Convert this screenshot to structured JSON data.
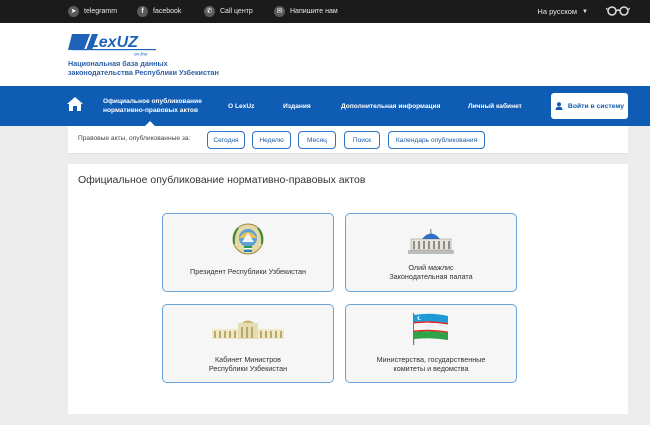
{
  "topbar": {
    "telegram": "telegramm",
    "facebook": "facebook",
    "call": "Call центр",
    "write": "Напишите нам",
    "language": "На русском"
  },
  "header": {
    "logo_text": "LexUZ",
    "logo_sub": "on-line",
    "slogan_line1": "Национальная база данных",
    "slogan_line2": "законодательства Республики Узбекистан"
  },
  "nav": {
    "active_line1": "Официальное опубликование",
    "active_line2": "нормативно-правовых актов",
    "about": "О LexUz",
    "publications": "Издания",
    "additional": "Дополнительная информация",
    "cabinet": "Личный кабинет",
    "login": "Войти в систему"
  },
  "filter": {
    "label": "Правовые акты, опубликованные за:",
    "chips": [
      "Сегодня",
      "Неделю",
      "Месяц",
      "Поиск",
      "Календарь опубликования"
    ]
  },
  "main": {
    "title": "Официальное опубликование нормативно-правовых актов",
    "cards": [
      {
        "line1": "Президент Республики Узбекистан",
        "line2": ""
      },
      {
        "line1": "Олий мажлис",
        "line2": "Законодательная палата"
      },
      {
        "line1": "Кабинет Министров",
        "line2": "Республики Узбекистан"
      },
      {
        "line1": "Министерства, государственные",
        "line2": "комитеты и ведомства"
      }
    ]
  },
  "colors": {
    "nav_blue": "#0e5cb4",
    "topbar_dark": "#1b1b1b",
    "card_border": "#6aa3d8"
  }
}
